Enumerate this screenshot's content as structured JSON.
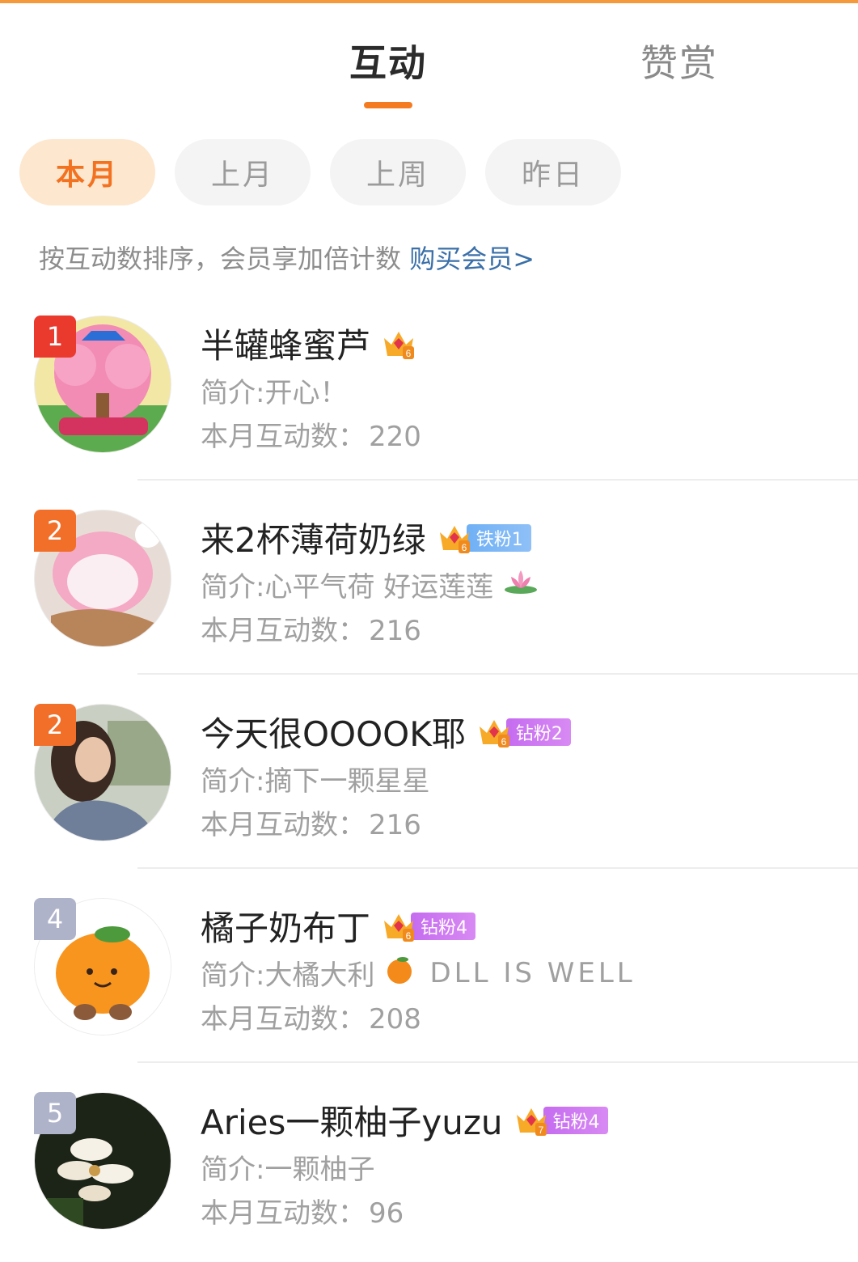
{
  "tabs": {
    "active": "互动",
    "inactive": "赞赏"
  },
  "filters": [
    "本月",
    "上月",
    "上周",
    "昨日"
  ],
  "hint": {
    "text": "按互动数排序，会员享加倍计数",
    "link": "购买会员>"
  },
  "count_label": "本月互动数：",
  "ranking": [
    {
      "rank": "1",
      "name": "半罐蜂蜜芦",
      "crown_level": "6",
      "fan_badge": "",
      "intro": "简介:开心！",
      "count": "220"
    },
    {
      "rank": "2",
      "name": "来2杯薄荷奶绿",
      "crown_level": "6",
      "fan_badge": "铁粉1",
      "intro": "简介:心平气荷 好运莲莲",
      "count": "216"
    },
    {
      "rank": "2",
      "name": "今天很OOOOK耶",
      "crown_level": "6",
      "fan_badge": "钻粉2",
      "intro": "简介:摘下一颗星星",
      "count": "216"
    },
    {
      "rank": "4",
      "name": "橘子奶布丁",
      "crown_level": "6",
      "fan_badge": "钻粉4",
      "intro": "简介:大橘大利",
      "intro_extra": "DLL IS WELL",
      "count": "208"
    },
    {
      "rank": "5",
      "name": "Aries一颗柚子yuzu",
      "crown_level": "7",
      "fan_badge": "钻粉4",
      "intro": "简介:一颗柚子",
      "count": "96"
    }
  ],
  "colors": {
    "accent": "#f47b20",
    "link": "#3a6fa8",
    "iron_fan": "#6fb0f5",
    "diamond_fan": "#c56cf0"
  }
}
